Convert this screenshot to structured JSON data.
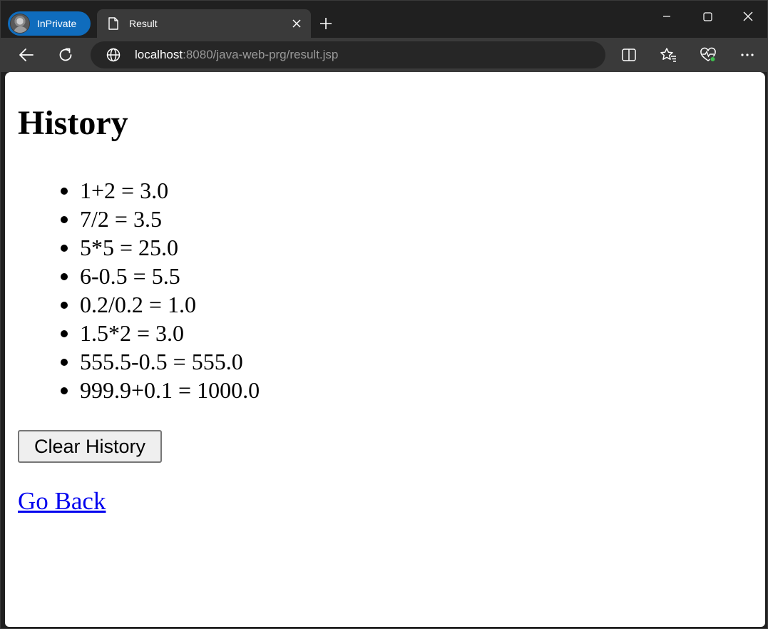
{
  "browser": {
    "inprivate_label": "InPrivate",
    "tab_title": "Result",
    "url_host": "localhost",
    "url_rest": ":8080/java-web-prg/result.jsp"
  },
  "page": {
    "title": "History",
    "history": [
      "1+2 = 3.0",
      "7/2 = 3.5",
      "5*5 = 25.0",
      "6-0.5 = 5.5",
      "0.2/0.2 = 1.0",
      "1.5*2 = 3.0",
      "555.5-0.5 = 555.0",
      "999.9+0.1 = 1000.0"
    ],
    "clear_button": "Clear History",
    "back_link": "Go Back"
  },
  "colors": {
    "inprivate_accent": "#0f6cbd",
    "link": "#0000ee",
    "chrome_dark": "#202020",
    "toolbar": "#3a3a3a"
  },
  "icons": [
    "avatar",
    "page-icon",
    "close-icon",
    "plus-icon",
    "minimize-icon",
    "maximize-icon",
    "window-close-icon",
    "back-arrow-icon",
    "refresh-icon",
    "globe-icon",
    "split-screen-icon",
    "favorites-icon",
    "browser-essentials-icon",
    "more-icon"
  ]
}
